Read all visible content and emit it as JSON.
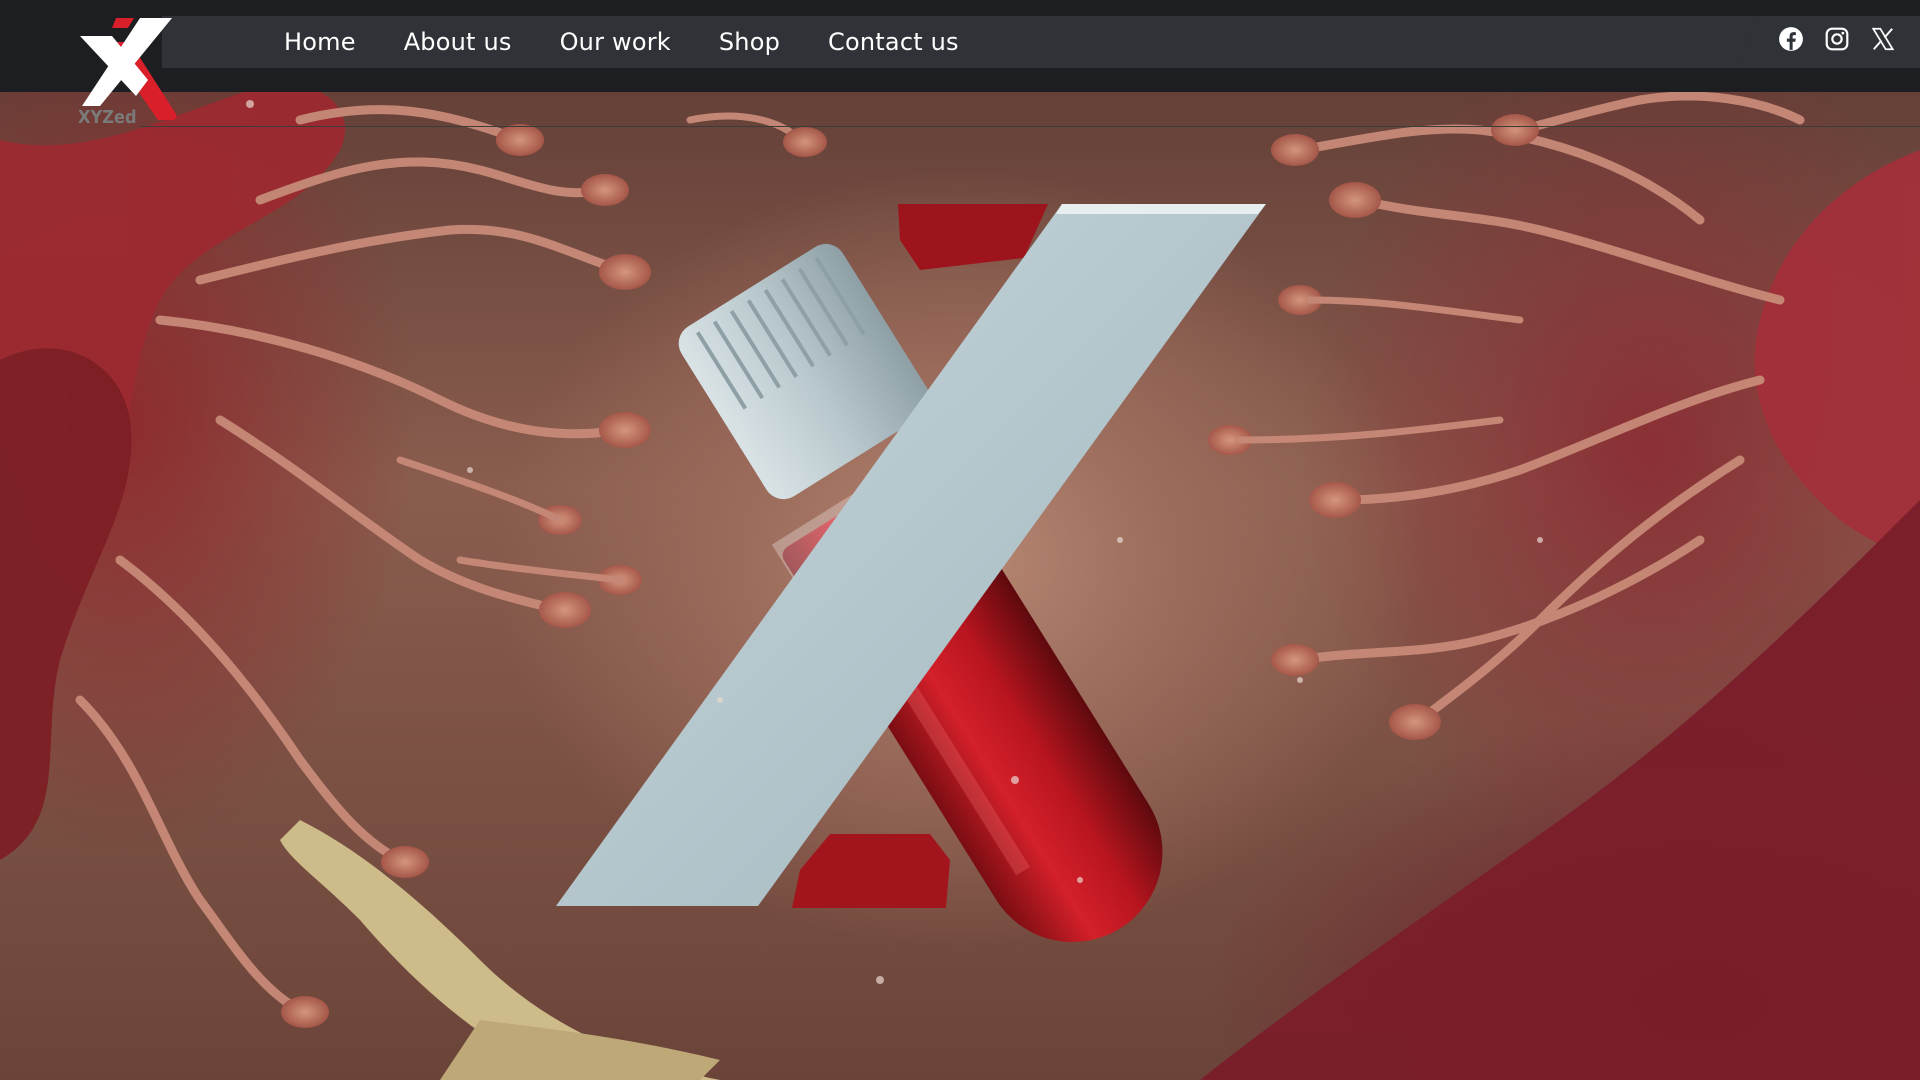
{
  "brand": {
    "logo_text": "XYZed"
  },
  "nav": {
    "items": [
      {
        "label": "Home"
      },
      {
        "label": "About us"
      },
      {
        "label": "Our work"
      },
      {
        "label": "Shop"
      },
      {
        "label": "Contact us"
      }
    ]
  },
  "social": {
    "icons": [
      "facebook-icon",
      "instagram-icon",
      "x-twitter-icon"
    ]
  },
  "colors": {
    "header_bg": "#1c1e21",
    "nav_bg": "#2f3337",
    "accent_red": "#d81f2a",
    "nav_text": "#ffffff"
  }
}
